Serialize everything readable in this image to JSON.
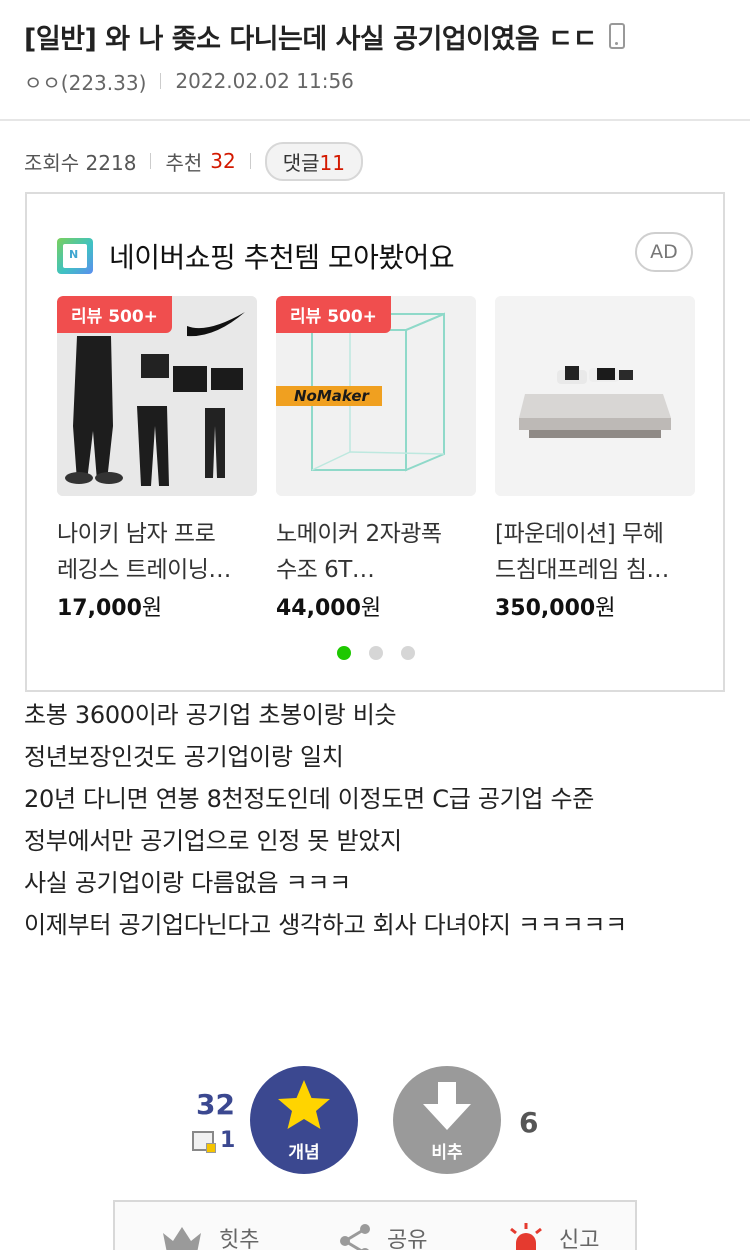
{
  "post": {
    "title": "[일반] 와 나 좆소 다니는데 사실 공기업이였음 ㄷㄷ",
    "author": "ㅇㅇ(223.33)",
    "date": "2022.02.02 11:56",
    "views_label": "조회수 2218",
    "recommend_label": "추천",
    "recommend_count": "32",
    "comments_label": "댓글",
    "comments_count": "11"
  },
  "ad": {
    "title": "네이버쇼핑 추천템 모아봤어요",
    "badge": "AD",
    "products": [
      {
        "badge": "리뷰 500+",
        "name_line1": "나이키 남자 프로",
        "name_line2": "레깅스 트레이닝…",
        "price": "17,000",
        "unit": "원"
      },
      {
        "badge": "리뷰 500+",
        "name_line1": "노메이커 2자광폭",
        "name_line2": "수조 6T…",
        "price": "44,000",
        "unit": "원",
        "brand": "NoMaker"
      },
      {
        "badge": "",
        "name_line1": "[파운데이션] 무헤",
        "name_line2": "드침대프레임 침…",
        "price": "350,000",
        "unit": "원"
      }
    ],
    "carousel_active_index": 0
  },
  "body_lines": [
    "초봉 3600이라 공기업 초봉이랑 비슷",
    "정년보장인것도 공기업이랑 일치",
    "20년 다니면 연봉 8천정도인데 이정도면 C급 공기업 수준",
    "정부에서만 공기업으로 인정 못 받았지",
    "사실 공기업이랑 다름없음 ㅋㅋㅋ",
    "이제부터 공기업다닌다고 생각하고 회사 다녀야지 ㅋㅋㅋㅋㅋ"
  ],
  "vote": {
    "up_count": "32",
    "fix_count": "1",
    "up_label": "개념",
    "down_label": "비추",
    "down_count": "6"
  },
  "actions": {
    "hit_label": "힛추",
    "share_label": "공유",
    "report_label": "신고"
  },
  "colors": {
    "accent_red": "#d31900",
    "vote_blue": "#3b4890",
    "naver_green": "#1ec800",
    "review_badge": "#f04e4e"
  }
}
